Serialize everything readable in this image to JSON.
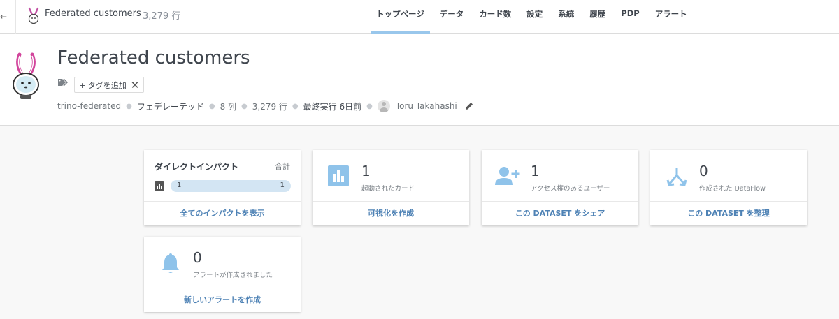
{
  "topbar": {
    "back_glyph": "←",
    "dataset_name": "Federated customers",
    "rows": "3,279 行",
    "tabs": [
      {
        "label": "トップページ",
        "active": true
      },
      {
        "label": "データ"
      },
      {
        "label": "カード数"
      },
      {
        "label": "設定"
      },
      {
        "label": "系統"
      },
      {
        "label": "履歴"
      },
      {
        "label": "PDP"
      },
      {
        "label": "アラート"
      }
    ]
  },
  "header": {
    "title": "Federated customers",
    "add_tag_label": "+ タグを追加",
    "meta": {
      "connector": "trino-federated",
      "type": "フェデレーテッド",
      "columns": "8 列",
      "rows": "3,279 行",
      "last_run": "最終実行 6日前",
      "owner": "Toru Takahashi"
    }
  },
  "cards": {
    "impact": {
      "title": "ダイレクトインパクト",
      "total_label": "合計",
      "bar_left": "1",
      "bar_right": "1",
      "footer": "全てのインパクトを表示"
    },
    "cards_launched": {
      "count": "1",
      "label": "起動されたカード",
      "footer": "可視化を作成"
    },
    "users": {
      "count": "1",
      "label": "アクセス権のあるユーザー",
      "footer": "この DATASET をシェア"
    },
    "dataflow": {
      "count": "0",
      "label": "作成された DataFlow",
      "footer": "この DATASET を整理"
    },
    "alerts": {
      "count": "0",
      "label": "アラートが作成されました",
      "footer": "新しいアラートを作成"
    }
  },
  "colors": {
    "accent": "#99c7ec",
    "link": "#4e82b5",
    "icon_blue": "#8fc3ea",
    "bar_fill": "#d3e5f3"
  },
  "icons": [
    "back-arrow-icon",
    "rabbit-logo-icon",
    "tag-icon",
    "close-icon",
    "avatar-icon",
    "pencil-icon",
    "bar-chart-icon",
    "add-user-icon",
    "dataflow-icon",
    "bell-icon"
  ]
}
